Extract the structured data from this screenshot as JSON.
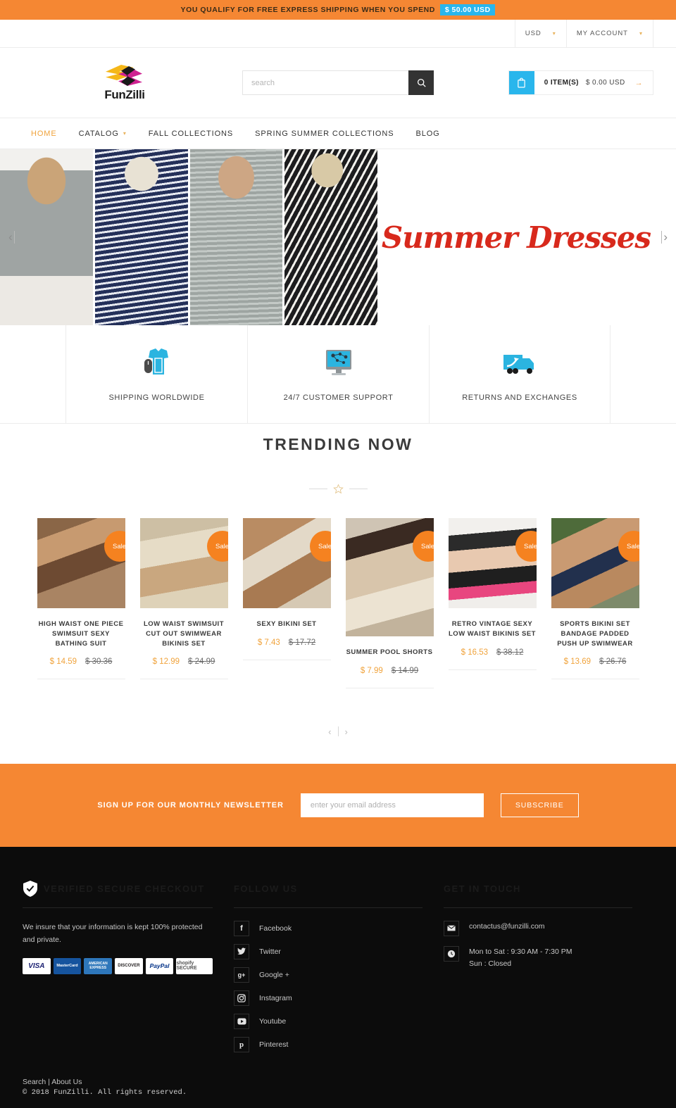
{
  "promo": {
    "text": "YOU QUALIFY FOR FREE EXPRESS SHIPPING WHEN YOU SPEND",
    "amount": "$ 50.00 USD"
  },
  "utility": {
    "currency": "USD",
    "account": "MY ACCOUNT"
  },
  "brand": {
    "name": "FunZilli"
  },
  "search": {
    "placeholder": "search",
    "icon": "search-icon"
  },
  "cart": {
    "items": "0 ITEM(S)",
    "total": "$ 0.00 USD",
    "icon": "shopping-bag-icon"
  },
  "nav": {
    "items": [
      {
        "label": "HOME",
        "active": true,
        "caret": false
      },
      {
        "label": "CATALOG",
        "active": false,
        "caret": true
      },
      {
        "label": "FALL COLLECTIONS",
        "active": false,
        "caret": false
      },
      {
        "label": "SPRING SUMMER COLLECTIONS",
        "active": false,
        "caret": false
      },
      {
        "label": "BLOG",
        "active": false,
        "caret": false
      }
    ]
  },
  "hero": {
    "title": "Summer Dresses",
    "prev": "‹",
    "next": "›"
  },
  "features": [
    {
      "label": "SHIPPING WORLDWIDE",
      "icon": "tshirt-mouse-icon"
    },
    {
      "label": "24/7 CUSTOMER SUPPORT",
      "icon": "monitor-support-icon"
    },
    {
      "label": "RETURNS AND EXCHANGES",
      "icon": "delivery-truck-icon"
    }
  ],
  "trending": {
    "heading": "TRENDING NOW",
    "badge": "Sale",
    "prev": "‹",
    "next": "›",
    "products": [
      {
        "title": "HIGH WAIST ONE PIECE SWIMSUIT SEXY BATHING SUIT",
        "price": "$ 14.59",
        "compare": "$ 30.36"
      },
      {
        "title": "LOW WAIST SWIMSUIT CUT OUT SWIMWEAR BIKINIS SET",
        "price": "$ 12.99",
        "compare": "$ 24.99"
      },
      {
        "title": "SEXY BIKINI SET",
        "price": "$ 7.43",
        "compare": "$ 17.72"
      },
      {
        "title": "SUMMER POOL SHORTS",
        "price": "$ 7.99",
        "compare": "$ 14.99"
      },
      {
        "title": "RETRO VINTAGE SEXY LOW WAIST BIKINIS SET",
        "price": "$ 16.53",
        "compare": "$ 38.12"
      },
      {
        "title": "SPORTS BIKINI SET BANDAGE PADDED PUSH UP SWIMWEAR",
        "price": "$ 13.69",
        "compare": "$ 26.76"
      }
    ]
  },
  "newsletter": {
    "label": "SIGN UP FOR OUR MONTHLY NEWSLETTER",
    "placeholder": "enter your email address",
    "button": "SUBSCRIBE"
  },
  "footer": {
    "secure": {
      "heading": "VERIFIED SECURE CHECKOUT",
      "text": "We insure that your information is kept 100% protected and private.",
      "payments": [
        "VISA",
        "MasterCard",
        "AMERICAN EXPRESS",
        "DISCOVER",
        "PayPal",
        "shopify SECURE"
      ]
    },
    "follow": {
      "heading": "FOLLOW US",
      "items": [
        {
          "label": "Facebook",
          "icon": "facebook-icon",
          "glyph": "f"
        },
        {
          "label": "Twitter",
          "icon": "twitter-icon",
          "glyph": "✉"
        },
        {
          "label": "Google +",
          "icon": "google-plus-icon",
          "glyph": "g+"
        },
        {
          "label": "Instagram",
          "icon": "instagram-icon",
          "glyph": "▣"
        },
        {
          "label": "Youtube",
          "icon": "youtube-icon",
          "glyph": "▶"
        },
        {
          "label": "Pinterest",
          "icon": "pinterest-icon",
          "glyph": "p"
        }
      ]
    },
    "contact": {
      "heading": "GET IN TOUCH",
      "email": "contactus@funzilli.com",
      "hours_line1": "Mon to Sat : 9:30 AM - 7:30 PM",
      "hours_line2": "Sun : Closed"
    }
  },
  "bottom": {
    "link_search": "Search",
    "separator": "|",
    "link_about": "About Us",
    "copyright": "© 2018 FunZilli. All rights reserved."
  }
}
